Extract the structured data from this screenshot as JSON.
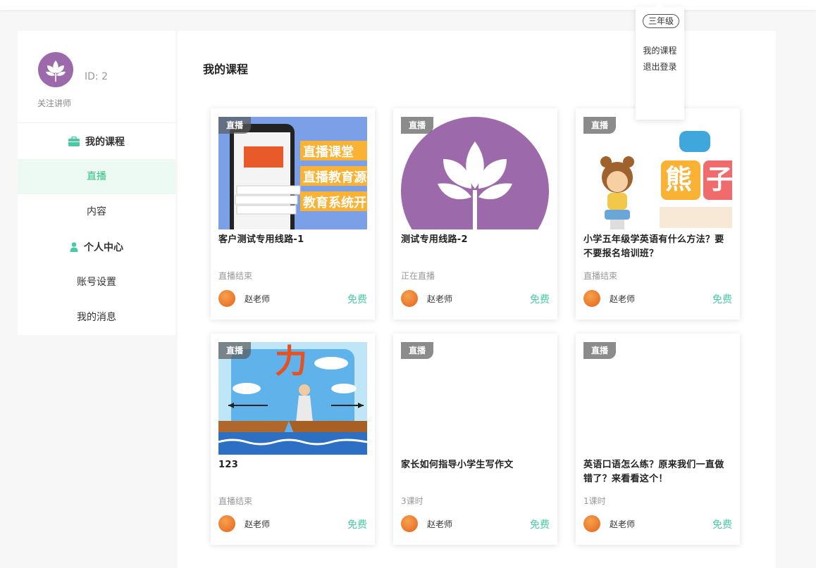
{
  "header": {
    "grade": "三年级",
    "menu": [
      "我的课程",
      "退出登录"
    ]
  },
  "profile": {
    "id_text": "ID: 2",
    "follow_text": "关注讲师",
    "avatar_color": "#9c6aab"
  },
  "sidebar": {
    "section1": "我的课程",
    "items1": [
      "直播",
      "内容"
    ],
    "section2": "个人中心",
    "items2": [
      "账号设置",
      "我的消息"
    ],
    "accent": "#2fbf84"
  },
  "main": {
    "title": "我的课程",
    "cards": [
      {
        "tag": "直播",
        "title": "客户测试专用线路-1",
        "status": "直播结束",
        "teacher": "赵老师",
        "price": "免费",
        "thumb_texts": [
          "直播课堂",
          "直播教育源码",
          "教育系统开"
        ]
      },
      {
        "tag": "直播",
        "title": "测试专用线路-2",
        "status": "正在直播",
        "teacher": "赵老师",
        "price": "免费"
      },
      {
        "tag": "直播",
        "title": "小学五年级学英语有什么方法？要不要报名培训班？",
        "status": "直播结束",
        "teacher": "赵老师",
        "price": "免费",
        "thumb_texts": [
          "熊",
          "子"
        ]
      },
      {
        "tag": "直播",
        "title": "123",
        "status": "直播结束",
        "teacher": "赵老师",
        "price": "免费",
        "thumb_texts": [
          "力"
        ]
      },
      {
        "tag": "直播",
        "title": "家长如何指导小学生写作文",
        "status": "3课时",
        "teacher": "赵老师",
        "price": "免费"
      },
      {
        "tag": "直播",
        "title": "英语口语怎么练？原来我们一直做错了？来看看这个！",
        "status": "1课时",
        "teacher": "赵老师",
        "price": "免费"
      }
    ]
  }
}
